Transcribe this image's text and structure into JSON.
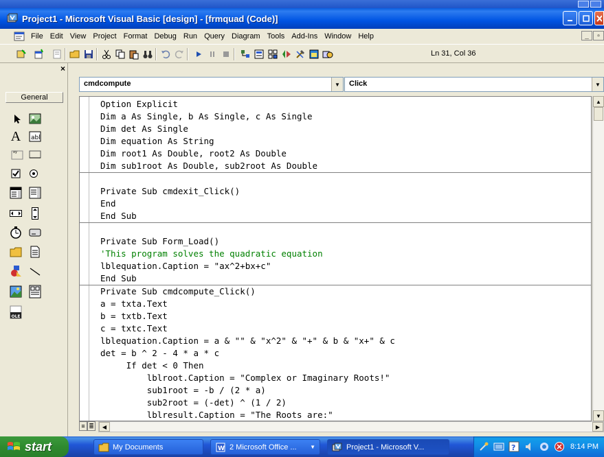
{
  "window": {
    "title": "Project1 - Microsoft Visual Basic [design] - [frmquad (Code)]"
  },
  "menu": {
    "items": [
      "File",
      "Edit",
      "View",
      "Project",
      "Format",
      "Debug",
      "Run",
      "Query",
      "Diagram",
      "Tools",
      "Add-Ins",
      "Window",
      "Help"
    ]
  },
  "toolbar": {
    "cursor_position": "Ln 31, Col 36"
  },
  "toolbox": {
    "tab_label": "General"
  },
  "code_window": {
    "object_combo": "cmdcompute",
    "procedure_combo": "Click",
    "lines": [
      "Option Explicit",
      "Dim a As Single, b As Single, c As Single",
      "Dim det As Single",
      "Dim equation As String",
      "Dim root1 As Double, root2 As Double",
      "Dim sub1root As Double, sub2root As Double",
      "",
      "Private Sub cmdexit_Click()",
      "End",
      "End Sub",
      "",
      "Private Sub Form_Load()",
      "'This program solves the quadratic equation",
      "lblequation.Caption = \"ax^2+bx+c\"",
      "End Sub",
      "Private Sub cmdcompute_Click()",
      "a = txta.Text",
      "b = txtb.Text",
      "c = txtc.Text",
      "lblequation.Caption = a & \"\" & \"x^2\" & \"+\" & b & \"x+\" & c",
      "det = b ^ 2 - 4 * a * c",
      "     If det < 0 Then",
      "         lblroot.Caption = \"Complex or Imaginary Roots!\"",
      "         sub1root = -b / (2 * a)",
      "         sub2root = (-det) ^ (1 / 2)",
      "         lblresult.Caption = \"The Roots are:\""
    ],
    "comment_color": "#008000"
  },
  "taskbar": {
    "start_label": "start",
    "tasks": [
      "My Documents",
      "2 Microsoft Office ...",
      "Project1 - Microsoft V..."
    ],
    "clock": "8:14 PM"
  }
}
